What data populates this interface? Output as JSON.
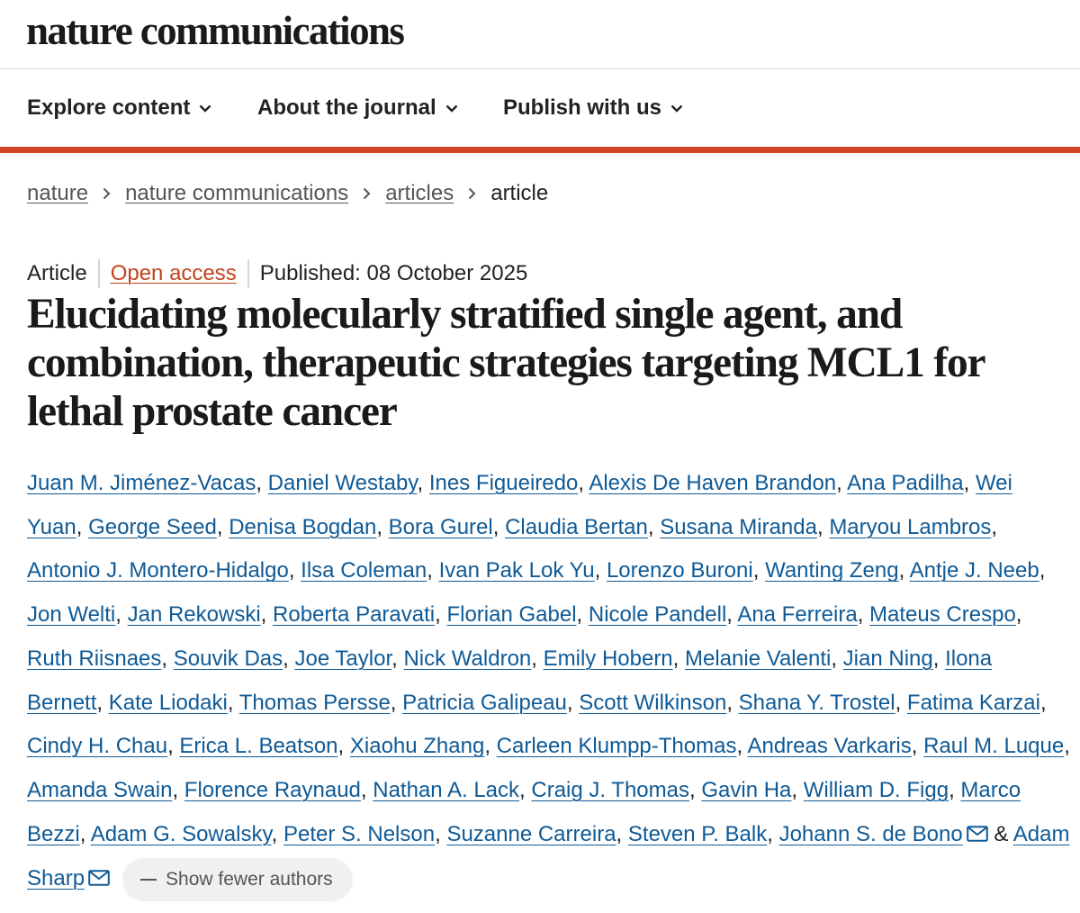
{
  "masthead": {
    "logo": "nature communications"
  },
  "nav": {
    "items": [
      {
        "label": "Explore content"
      },
      {
        "label": "About the journal"
      },
      {
        "label": "Publish with us"
      }
    ]
  },
  "breadcrumb": {
    "items": [
      "nature",
      "nature communications",
      "articles"
    ],
    "current": "article"
  },
  "meta": {
    "type": "Article",
    "access": "Open access",
    "published": "Published: 08 October 2025"
  },
  "article": {
    "title": "Elucidating molecularly stratified single agent, and combination, therapeutic strategies targeting MCL1 for lethal prostate cancer"
  },
  "authors": {
    "list": [
      "Juan M. Jiménez-Vacas",
      "Daniel Westaby",
      "Ines Figueiredo",
      "Alexis De Haven Brandon",
      "Ana Padilha",
      "Wei Yuan",
      "George Seed",
      "Denisa Bogdan",
      "Bora Gurel",
      "Claudia Bertan",
      "Susana Miranda",
      "Maryou Lambros",
      "Antonio J. Montero-Hidalgo",
      "Ilsa Coleman",
      "Ivan Pak Lok Yu",
      "Lorenzo Buroni",
      "Wanting Zeng",
      "Antje J. Neeb",
      "Jon Welti",
      "Jan Rekowski",
      "Roberta Paravati",
      "Florian Gabel",
      "Nicole Pandell",
      "Ana Ferreira",
      "Mateus Crespo",
      "Ruth Riisnaes",
      "Souvik Das",
      "Joe Taylor",
      "Nick Waldron",
      "Emily Hobern",
      "Melanie Valenti",
      "Jian Ning",
      "Ilona Bernett",
      "Kate Liodaki",
      "Thomas Persse",
      "Patricia Galipeau",
      "Scott Wilkinson",
      "Shana Y. Trostel",
      "Fatima Karzai",
      "Cindy H. Chau",
      "Erica L. Beatson",
      "Xiaohu Zhang",
      "Carleen Klumpp-Thomas",
      "Andreas Varkaris",
      "Raul M. Luque",
      "Amanda Swain",
      "Florence Raynaud",
      "Nathan A. Lack",
      "Craig J. Thomas",
      "Gavin Ha",
      "William D. Figg",
      "Marco Bezzi",
      "Adam G. Sowalsky",
      "Peter S. Nelson",
      "Suzanne Carreira",
      "Steven P. Balk",
      "Johann S. de Bono",
      "Adam Sharp"
    ],
    "corresponding": [
      "Johann S. de Bono",
      "Adam Sharp"
    ],
    "separator": ",",
    "last_joiner": "&",
    "toggle_label": "Show fewer authors"
  },
  "colors": {
    "accent_bar": "#d3452b",
    "link": "#0f5a96",
    "open_access": "#c4421b",
    "pill_bg": "#eef0f2"
  },
  "icons": {
    "nav_dropdown": "chevron-down-icon",
    "breadcrumb_separator": "chevron-right-icon",
    "corresponding_author": "envelope-icon",
    "toggle": "minus-icon"
  }
}
